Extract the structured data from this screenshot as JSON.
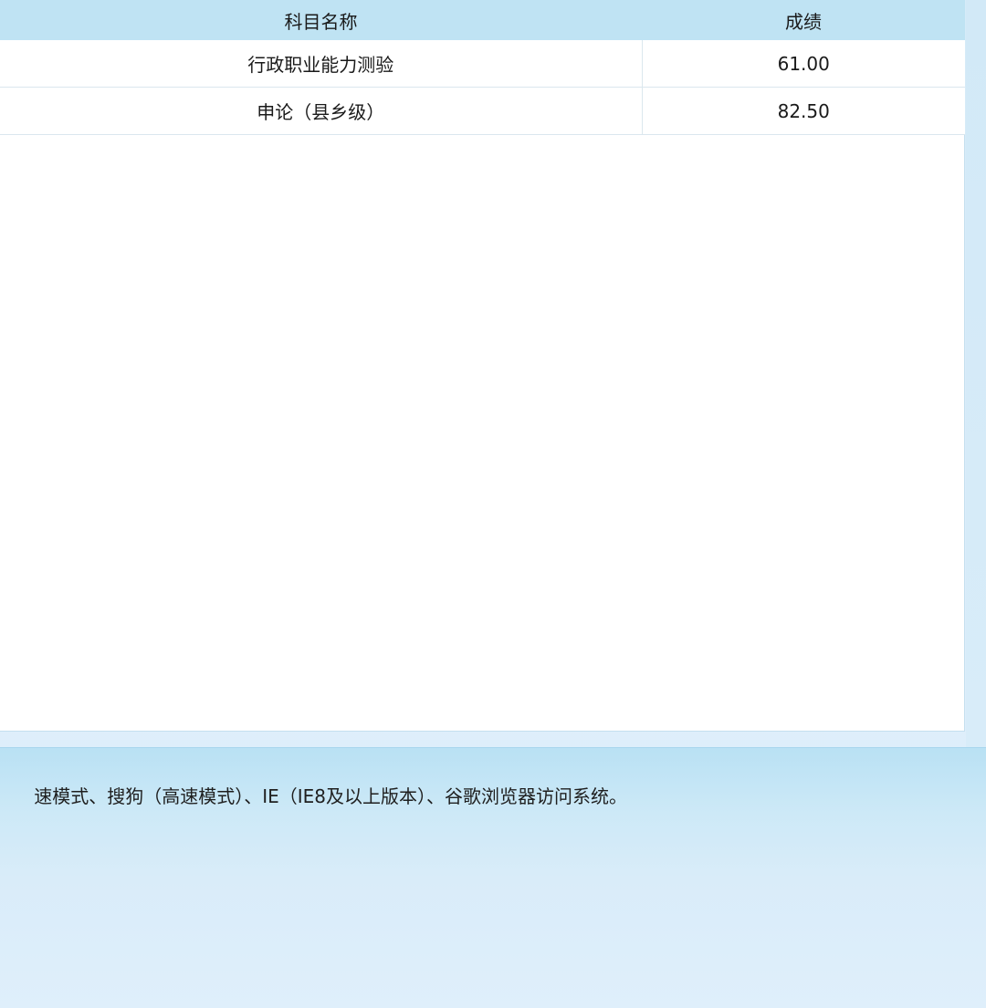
{
  "table": {
    "headers": {
      "subject": "科目名称",
      "score": "成绩"
    },
    "rows": [
      {
        "subject": "行政职业能力测验",
        "score": "61.00"
      },
      {
        "subject": "申论（县乡级）",
        "score": "82.50"
      }
    ]
  },
  "footer": {
    "notice": "速模式、搜狗（高速模式）、IE（IE8及以上版本）、谷歌浏览器访问系统。"
  }
}
